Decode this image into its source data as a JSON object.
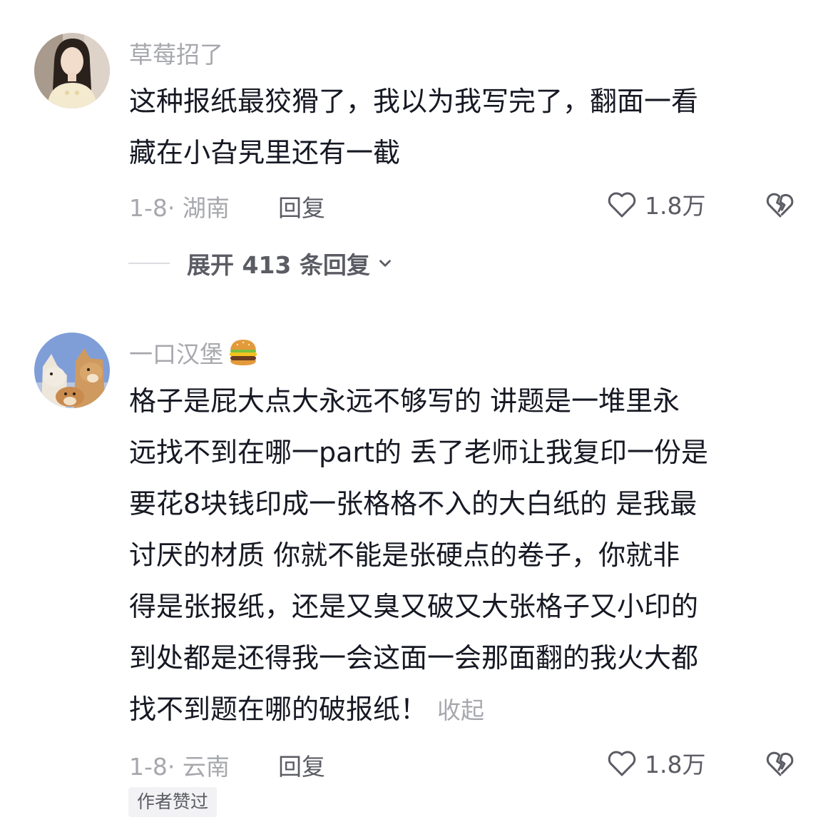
{
  "comments": [
    {
      "username": "草莓招了",
      "text_lines": [
        "这种报纸最狡猾了，我以为我写完了，翻面一看",
        "藏在小旮旯里还有一截"
      ],
      "meta": "1-8· 湖南",
      "reply_label": "回复",
      "likes": "1.8万",
      "expand_label": "展开 413 条回复",
      "icons": [
        "avatar",
        "heart-icon",
        "broken-heart-icon",
        "chevron-down-icon"
      ]
    },
    {
      "username": "一口汉堡",
      "username_emoji": "hamburger",
      "text_lines": [
        "格子是屁大点大永远不够写的  讲题是一堆里永",
        "远找不到在哪一part的  丢了老师让我复印一份是",
        "要花8块钱印成一张格格不入的大白纸的  是我最",
        "讨厌的材质  你就不能是张硬点的卷子，你就非",
        "得是张报纸，还是又臭又破又大张格子又小印的",
        "到处都是还得我一会这面一会那面翻的我火大都",
        "找不到题在哪的破报纸！"
      ],
      "collapse_label": "收起",
      "meta": "1-8· 云南",
      "reply_label": "回复",
      "likes": "1.8万",
      "badge": "作者赞过",
      "icons": [
        "avatar",
        "heart-icon",
        "broken-heart-icon",
        "hamburger-emoji"
      ]
    }
  ],
  "colors": {
    "text": "#161823",
    "secondary": "#a7a8ad",
    "action": "#5b5c64",
    "badge_bg": "#f2f2f4"
  }
}
